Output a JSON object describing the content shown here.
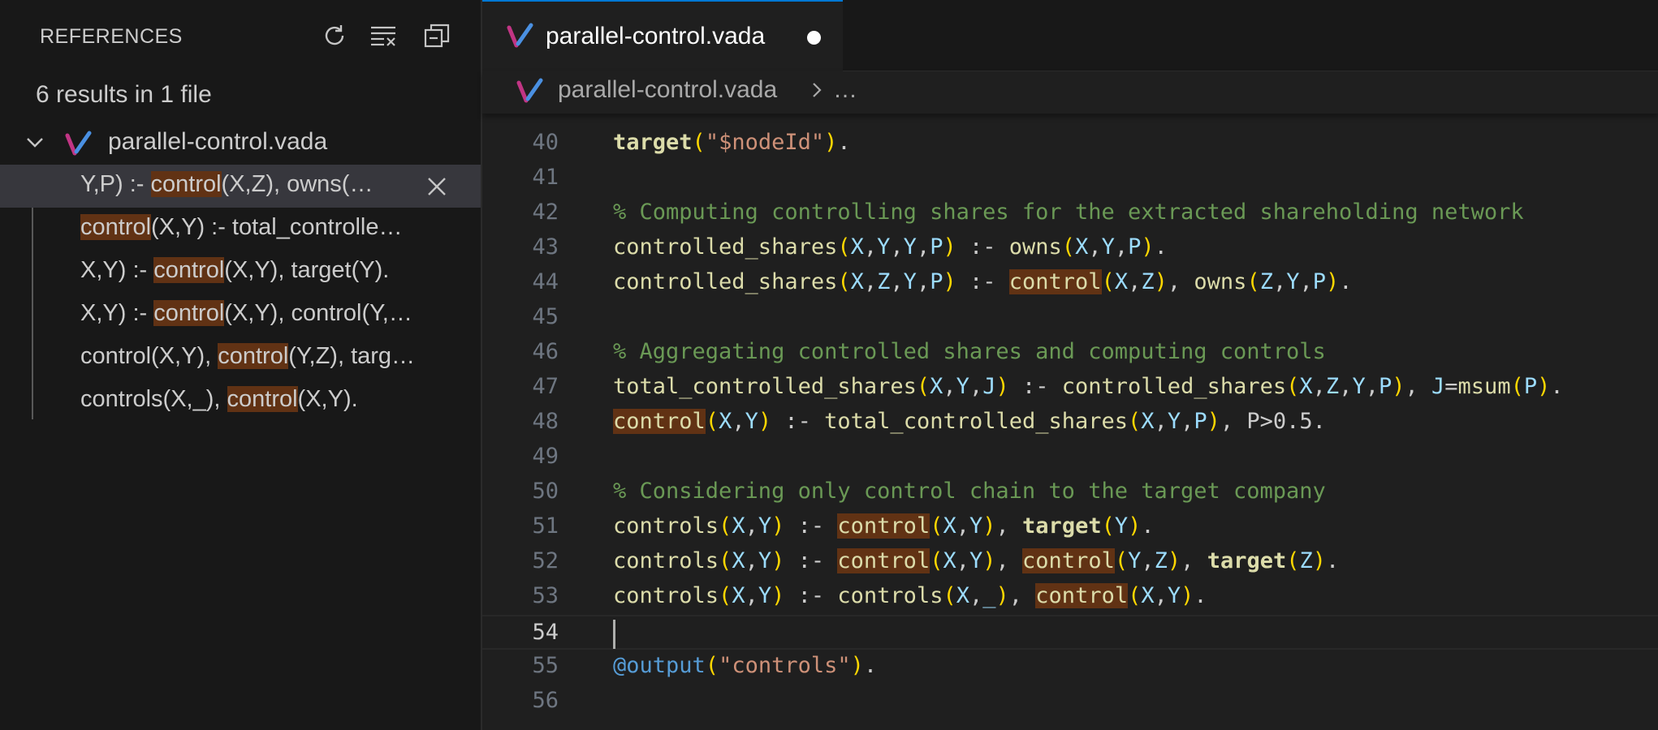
{
  "references_panel": {
    "title": "REFERENCES",
    "actions": [
      {
        "name": "refresh-icon"
      },
      {
        "name": "clear-all-icon"
      },
      {
        "name": "collapse-all-icon"
      }
    ],
    "summary": "6 results in 1 file",
    "file": {
      "name": "parallel-control.vada",
      "icon": "vada-file-icon",
      "expanded": true
    },
    "results": [
      {
        "pre": "Y,P) :- ",
        "match": "control",
        "post": "(X,Z), owns(…",
        "selected": true
      },
      {
        "pre": "",
        "match": "control",
        "post": "(X,Y) :- total_controlle…",
        "selected": false
      },
      {
        "pre": "X,Y) :- ",
        "match": "control",
        "post": "(X,Y), target(Y).",
        "selected": false
      },
      {
        "pre": "X,Y) :- ",
        "match": "control",
        "post": "(X,Y), control(Y,…",
        "selected": false
      },
      {
        "pre": "control(X,Y), ",
        "match": "control",
        "post": "(Y,Z), targ…",
        "selected": false
      },
      {
        "pre": "controls(X,_), ",
        "match": "control",
        "post": "(X,Y).",
        "selected": false
      }
    ]
  },
  "editor": {
    "tab": {
      "name": "parallel-control.vada",
      "modified": true
    },
    "breadcrumb": {
      "file": "parallel-control.vada",
      "more": "…"
    },
    "current_line": 54,
    "lines": [
      {
        "n": "40"
      },
      {
        "n": "41"
      },
      {
        "n": "42"
      },
      {
        "n": "43"
      },
      {
        "n": "44"
      },
      {
        "n": "45"
      },
      {
        "n": "46"
      },
      {
        "n": "47"
      },
      {
        "n": "48"
      },
      {
        "n": "49"
      },
      {
        "n": "50"
      },
      {
        "n": "51"
      },
      {
        "n": "52"
      },
      {
        "n": "53"
      },
      {
        "n": "54"
      },
      {
        "n": "55"
      },
      {
        "n": "56"
      }
    ],
    "tokens": {
      "l40": {
        "fn": "target",
        "s": "\"$nodeId\""
      },
      "l42": "% Computing controlling shares for the extracted shareholding network",
      "l43": {
        "head": "controlled_shares",
        "body": "owns"
      },
      "l44": {
        "head": "controlled_shares",
        "c": "control",
        "body": "owns"
      },
      "l46": "% Aggregating controlled shares and computing controls",
      "l47": {
        "head": "total_controlled_shares",
        "body": "controlled_shares",
        "agg": "msum"
      },
      "l48": {
        "c": "control",
        "body": "total_controlled_shares",
        "cond": "P>0.5."
      },
      "l50": "% Considering only control chain to the target company",
      "l51": {
        "head": "controls",
        "c": "control",
        "t": "target"
      },
      "l52": {
        "head": "controls",
        "c": "control",
        "t": "target"
      },
      "l53": {
        "head": "controls",
        "c": "control"
      },
      "l55": {
        "dec": "@output",
        "s": "\"controls\""
      }
    }
  },
  "colors": {
    "accent": "#0078d4",
    "match_highlight": "#613214",
    "comment": "#6a9955",
    "function": "#dcdcaa",
    "variable": "#9cdcfe",
    "string": "#ce9178",
    "bracket": "#ffd700"
  }
}
